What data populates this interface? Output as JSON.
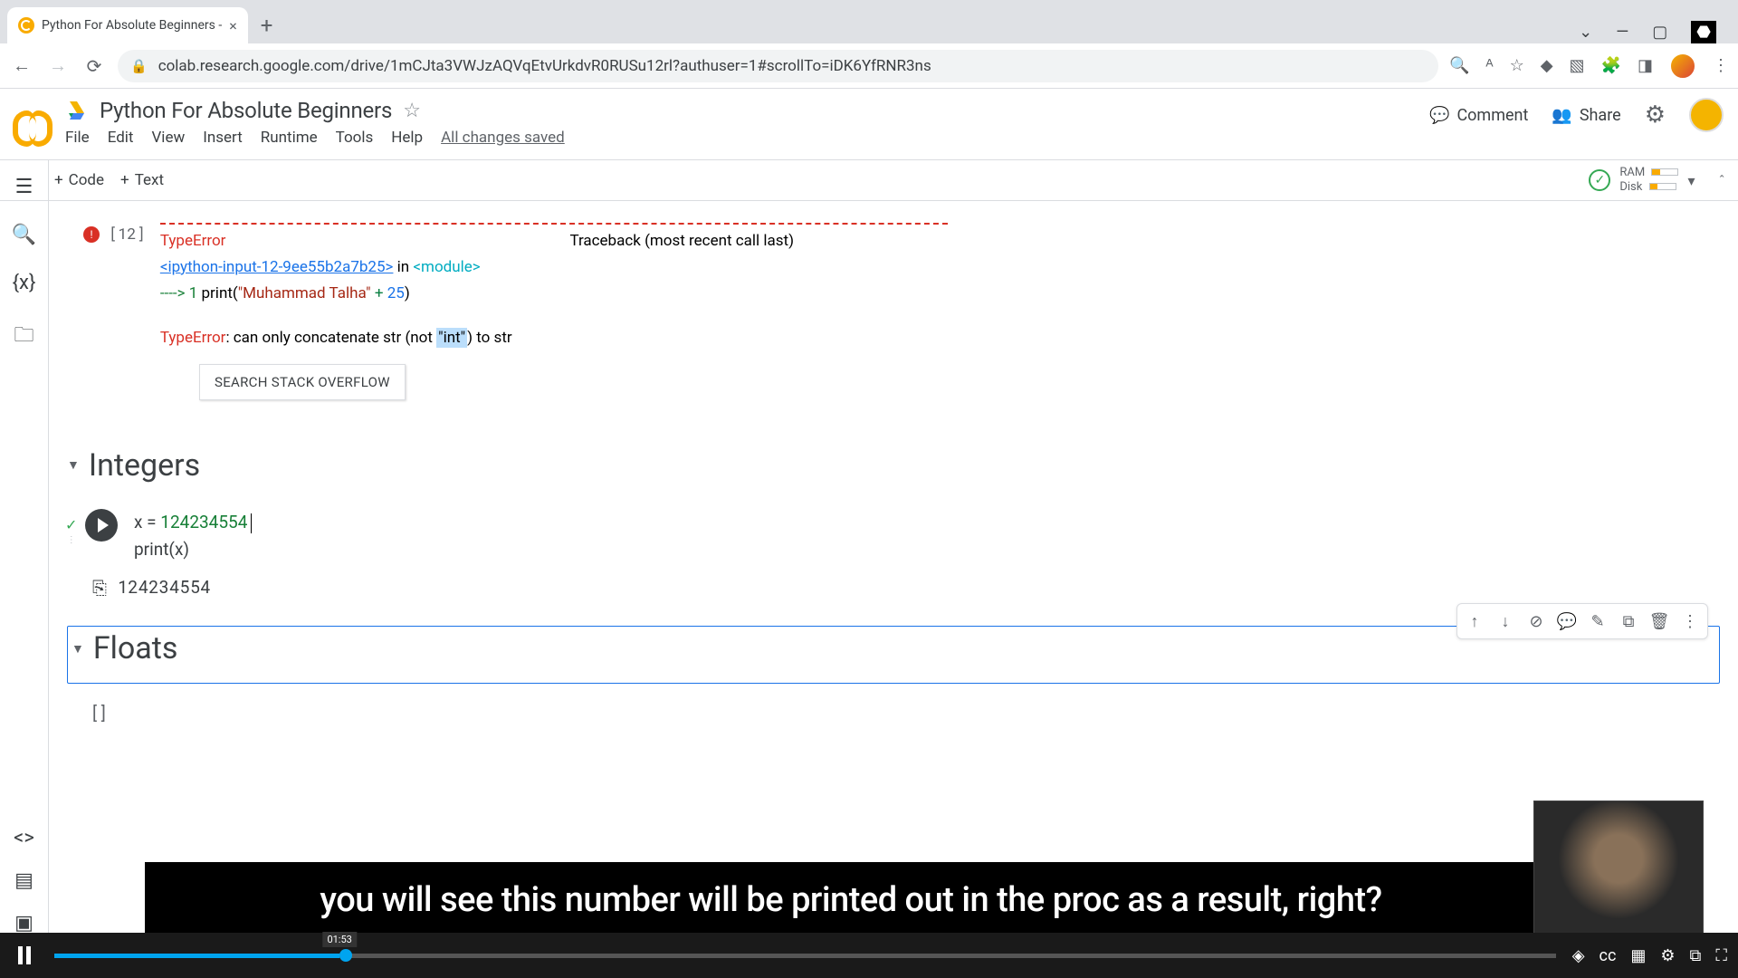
{
  "browser": {
    "tab_title": "Python For Absolute Beginners -",
    "url": "colab.research.google.com/drive/1mCJta3VWJzAQVqEtvUrkdvR0RUSu12rl?authuser=1#scrollTo=iDK6YfRNR3ns"
  },
  "colab": {
    "title": "Python For Absolute Beginners",
    "menu": {
      "file": "File",
      "edit": "Edit",
      "view": "View",
      "insert": "Insert",
      "runtime": "Runtime",
      "tools": "Tools",
      "help": "Help",
      "status": "All changes saved"
    },
    "header": {
      "comment": "Comment",
      "share": "Share"
    },
    "actions": {
      "code": "Code",
      "text": "Text"
    },
    "runtime_info": {
      "ram": "RAM",
      "disk": "Disk"
    }
  },
  "error_cell": {
    "prompt": "[12]",
    "type_error": "TypeError",
    "traceback": "Traceback (most recent call last)",
    "input_link": "<ipython-input-12-9ee55b2a7b25>",
    "in_word": " in ",
    "module": "<module>",
    "arrow_line": "----> 1",
    "print_call": "print",
    "str_lit": "\"Muhammad Talha\"",
    "plus": " + ",
    "num": "25",
    "te2": "TypeError",
    "msg1": ": can only concatenate str (not ",
    "int_hl": "\"int\"",
    "msg2": ") to str",
    "stack_btn": "SEARCH STACK OVERFLOW"
  },
  "sections": {
    "integers": "Integers",
    "floats": "Floats"
  },
  "int_cell": {
    "line1_var": "x = ",
    "line1_val": "124234554",
    "line2": "print(x)",
    "output": "124234554"
  },
  "empty_prompt": "[ ]",
  "caption": "you will see this number will be printed out in the proc as a result, right?",
  "player": {
    "time": "01:53"
  }
}
